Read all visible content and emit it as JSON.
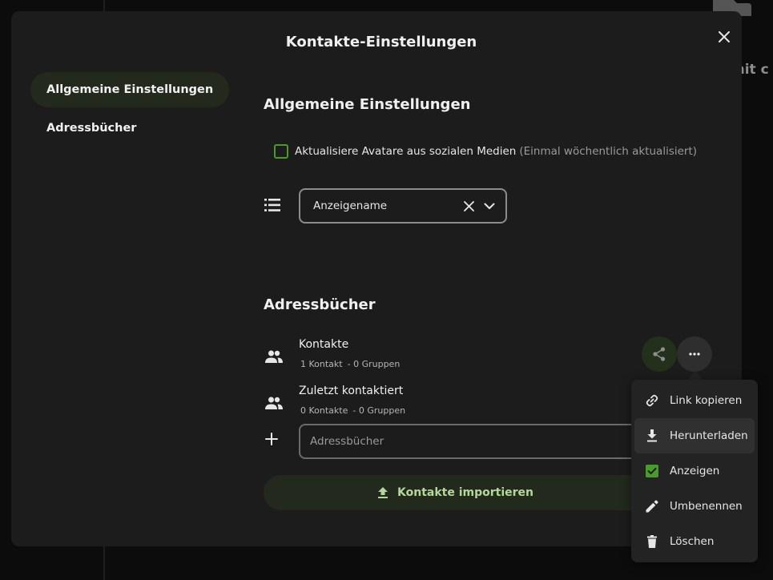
{
  "background": {
    "partial_text": "mit c"
  },
  "dialog": {
    "title": "Kontakte-Einstellungen"
  },
  "nav": {
    "items": [
      {
        "label": "Allgemeine Einstellungen"
      },
      {
        "label": "Adressbücher"
      }
    ]
  },
  "general": {
    "heading": "Allgemeine Einstellungen",
    "avatar_option": {
      "label": "Aktualisiere Avatare aus sozialen Medien",
      "hint": "(Einmal wöchentlich aktualisiert)",
      "checked": false
    },
    "sort_select": {
      "value": "Anzeigename"
    }
  },
  "addressbooks": {
    "heading": "Adressbücher",
    "items": [
      {
        "name": "Kontakte",
        "contacts": "1 Kontakt",
        "groups": "- 0 Gruppen"
      },
      {
        "name": "Zuletzt kontaktiert",
        "contacts": "0 Kontakte",
        "groups": "- 0 Gruppen"
      }
    ],
    "new_input": {
      "placeholder": "Adressbücher"
    },
    "import_label": "Kontakte importieren"
  },
  "menu": {
    "items": [
      {
        "label": "Link kopieren",
        "icon": "link-icon"
      },
      {
        "label": "Herunterladen",
        "icon": "download-icon"
      },
      {
        "label": "Anzeigen",
        "icon": "checkbox-checked-icon"
      },
      {
        "label": "Umbenennen",
        "icon": "pencil-icon"
      },
      {
        "label": "Löschen",
        "icon": "trash-icon"
      }
    ]
  },
  "colors": {
    "accent": "#4a9a2c",
    "accent_text": "#b4d89a",
    "dialog_bg": "#1c1c1c",
    "menu_bg": "#232323"
  }
}
